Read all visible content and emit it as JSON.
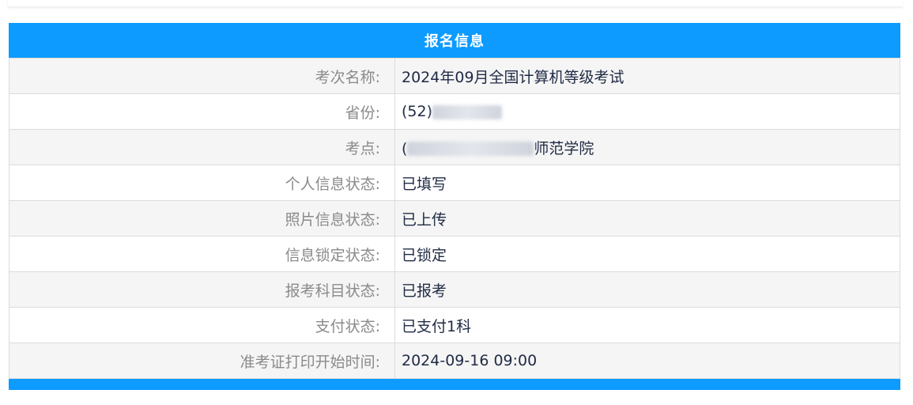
{
  "panel": {
    "title": "报名信息",
    "rows": [
      {
        "label": "考次名称:",
        "value": "2024年09月全国计算机等级考试"
      },
      {
        "label": "省份:",
        "value_visible_prefix": "(52)",
        "value_visible_suffix": "",
        "redacted": true
      },
      {
        "label": "考点:",
        "value_visible_prefix": "(",
        "value_visible_suffix": "师范学院",
        "redacted": true
      },
      {
        "label": "个人信息状态:",
        "value": "已填写"
      },
      {
        "label": "照片信息状态:",
        "value": "已上传"
      },
      {
        "label": "信息锁定状态:",
        "value": "已锁定"
      },
      {
        "label": "报考科目状态:",
        "value": "已报考"
      },
      {
        "label": "支付状态:",
        "value": "已支付1科"
      },
      {
        "label": "准考证打印开始时间:",
        "value": "2024-09-16 09:00"
      }
    ]
  },
  "colors": {
    "header_bg": "#0d9bff",
    "header_text": "#ffffff",
    "label_text": "#8a8a8a",
    "value_text": "#1f2a44",
    "row_alt_bg": "#f5f5f5",
    "border": "#dcdcdc"
  }
}
